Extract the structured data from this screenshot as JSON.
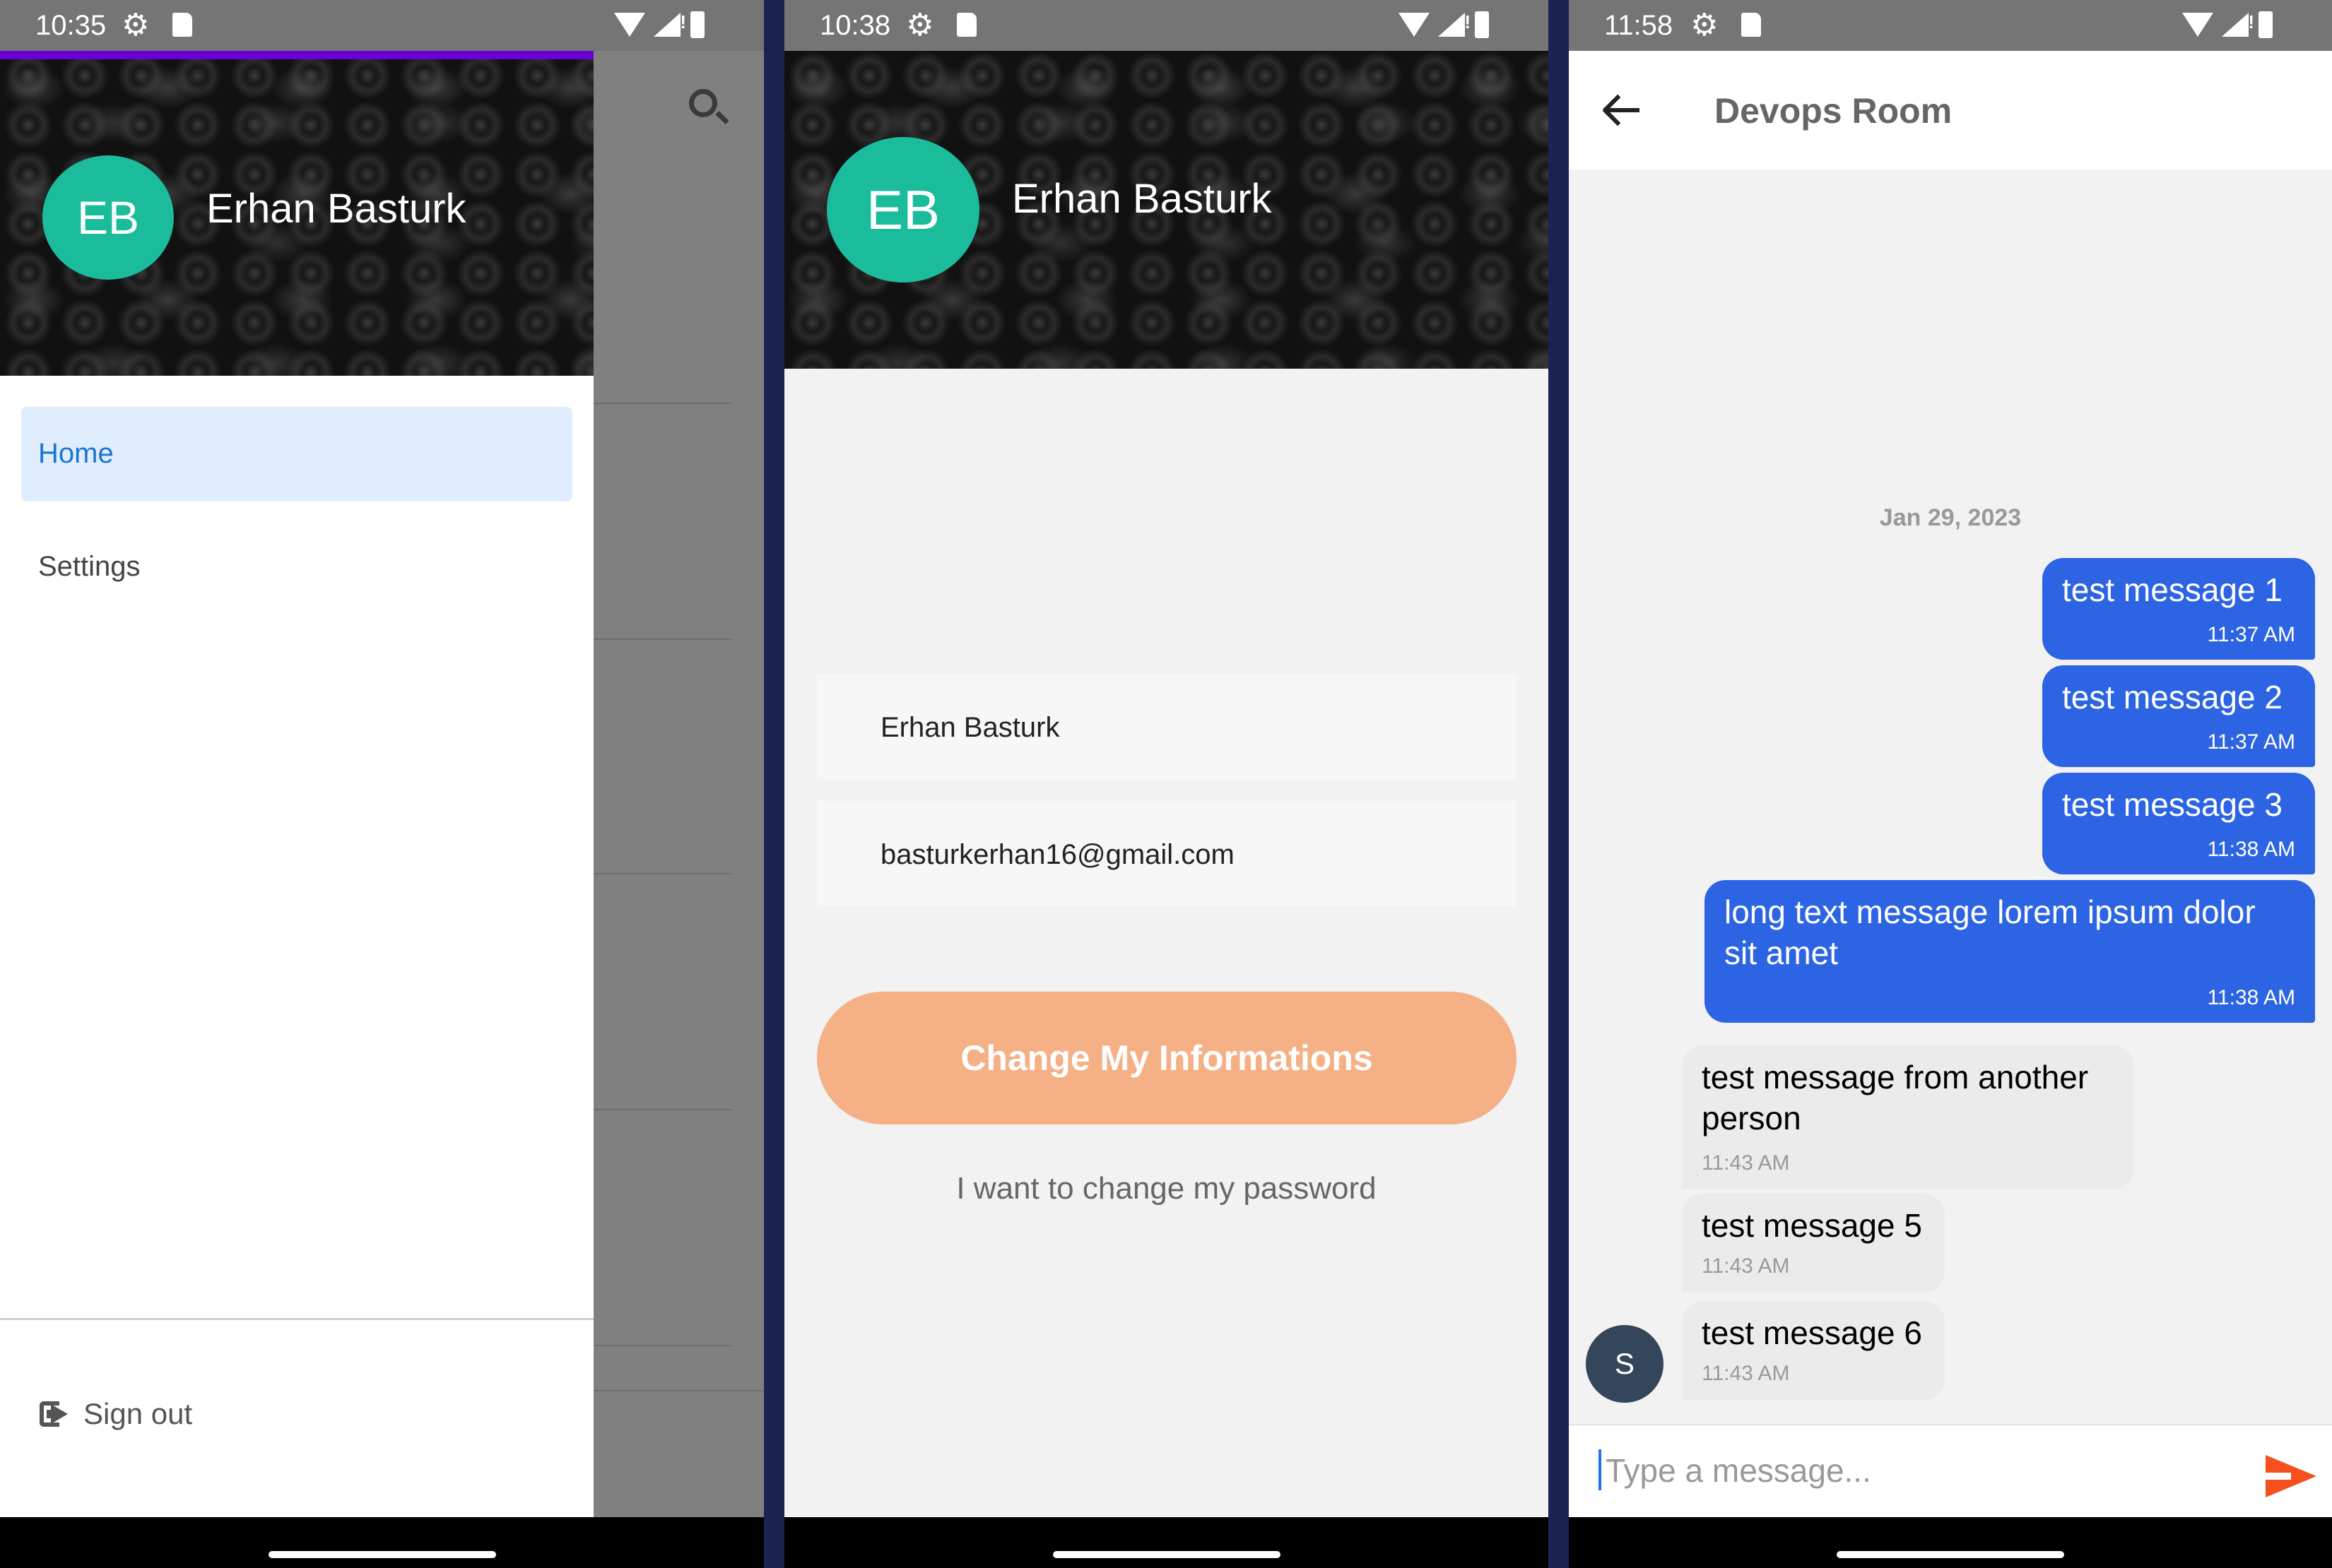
{
  "screens": {
    "drawer": {
      "status_time": "10:35",
      "user": {
        "initials": "EB",
        "name": "Erhan Basturk"
      },
      "menu": {
        "home": "Home",
        "settings": "Settings"
      },
      "sign_out": "Sign out"
    },
    "profile": {
      "status_time": "10:38",
      "user": {
        "initials": "EB",
        "name": "Erhan Basturk"
      },
      "fields": {
        "name": "Erhan Basturk",
        "email": "basturkerhan16@gmail.com"
      },
      "change_button": "Change My Informations",
      "password_link": "I want to change my password"
    },
    "chat": {
      "status_time": "11:58",
      "room_title": "Devops Room",
      "date": "Jan 29, 2023",
      "messages": [
        {
          "text": "test message 1",
          "time": "11:37 AM",
          "mine": true
        },
        {
          "text": "test message 2",
          "time": "11:37 AM",
          "mine": true
        },
        {
          "text": "test message 3",
          "time": "11:38 AM",
          "mine": true
        },
        {
          "text": "long text message lorem ipsum dolor sit amet",
          "time": "11:38 AM",
          "mine": true
        },
        {
          "text": "test message from another person",
          "time": "11:43 AM",
          "mine": false
        },
        {
          "text": "test message 5",
          "time": "11:43 AM",
          "mine": false
        },
        {
          "text": "test message 6",
          "time": "11:43 AM",
          "mine": false
        }
      ],
      "other_avatar_initial": "S",
      "input_placeholder": "Type a message..."
    }
  },
  "colors": {
    "accent_purple": "#6a00d4",
    "avatar_green": "#1abc9c",
    "home_highlight": "#e0edff",
    "home_text": "#1976d2",
    "button_orange": "#f5b086",
    "bubble_blue": "#2c64e3",
    "send_orange": "#f4511e"
  },
  "icons": {
    "status": [
      "gear-icon",
      "sd-card-icon",
      "wifi-icon",
      "signal-icon",
      "battery-icon"
    ],
    "drawer": [
      "search-icon",
      "sign-out-icon"
    ],
    "chat": [
      "back-arrow-icon",
      "send-icon"
    ]
  }
}
